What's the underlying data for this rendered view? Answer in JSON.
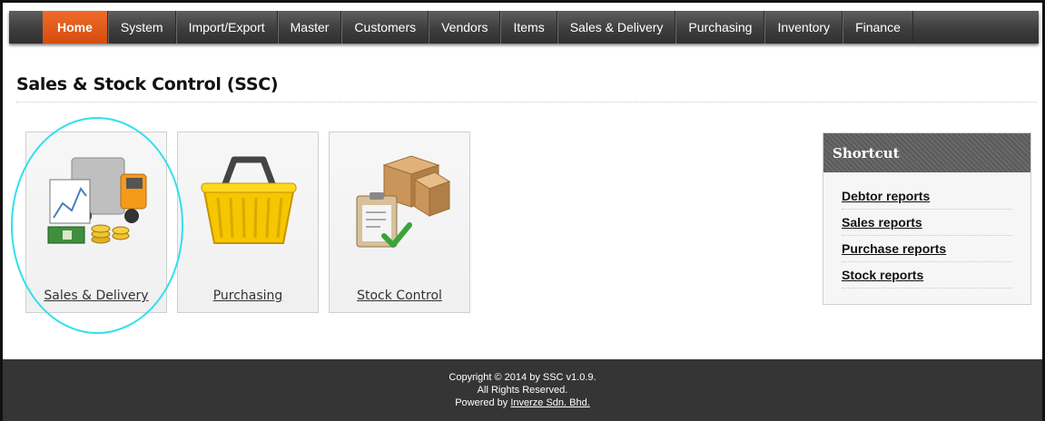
{
  "nav": {
    "items": [
      {
        "label": "Home",
        "active": true
      },
      {
        "label": "System"
      },
      {
        "label": "Import/Export"
      },
      {
        "label": "Master"
      },
      {
        "label": "Customers"
      },
      {
        "label": "Vendors"
      },
      {
        "label": "Items"
      },
      {
        "label": "Sales & Delivery"
      },
      {
        "label": "Purchasing"
      },
      {
        "label": "Inventory"
      },
      {
        "label": "Finance"
      }
    ]
  },
  "page": {
    "title": "Sales & Stock Control (SSC)"
  },
  "tiles": [
    {
      "label": "Sales & Delivery",
      "icon": "truck-cash-icon"
    },
    {
      "label": "Purchasing",
      "icon": "basket-icon"
    },
    {
      "label": "Stock Control",
      "icon": "boxes-clipboard-icon"
    }
  ],
  "shortcut": {
    "title": "Shortcut",
    "links": [
      "Debtor reports",
      "Sales reports",
      "Purchase reports",
      "Stock reports"
    ]
  },
  "footer": {
    "copyright": "Copyright © 2014 by SSC v1.0.9.",
    "rights": "All Rights Reserved.",
    "powered_prefix": "Powered by ",
    "powered_link": "Inverze Sdn. Bhd."
  },
  "colors": {
    "accent": "#e0561b",
    "highlight": "#2fe0ee",
    "footer": "#353535"
  }
}
